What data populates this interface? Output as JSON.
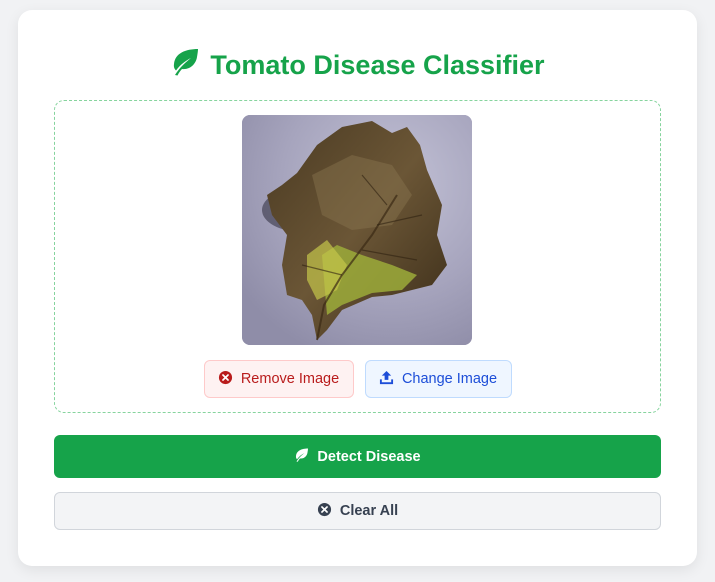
{
  "header": {
    "title": "Tomato Disease Classifier",
    "icon": "leaf-icon"
  },
  "upload": {
    "preview_alt": "Uploaded tomato leaf image",
    "remove_label": "Remove Image",
    "change_label": "Change Image"
  },
  "actions": {
    "detect_label": "Detect Disease",
    "clear_label": "Clear All"
  },
  "colors": {
    "primary": "#16a34a",
    "remove_text": "#b91c1c",
    "change_text": "#1d4ed8",
    "clear_text": "#374151"
  }
}
